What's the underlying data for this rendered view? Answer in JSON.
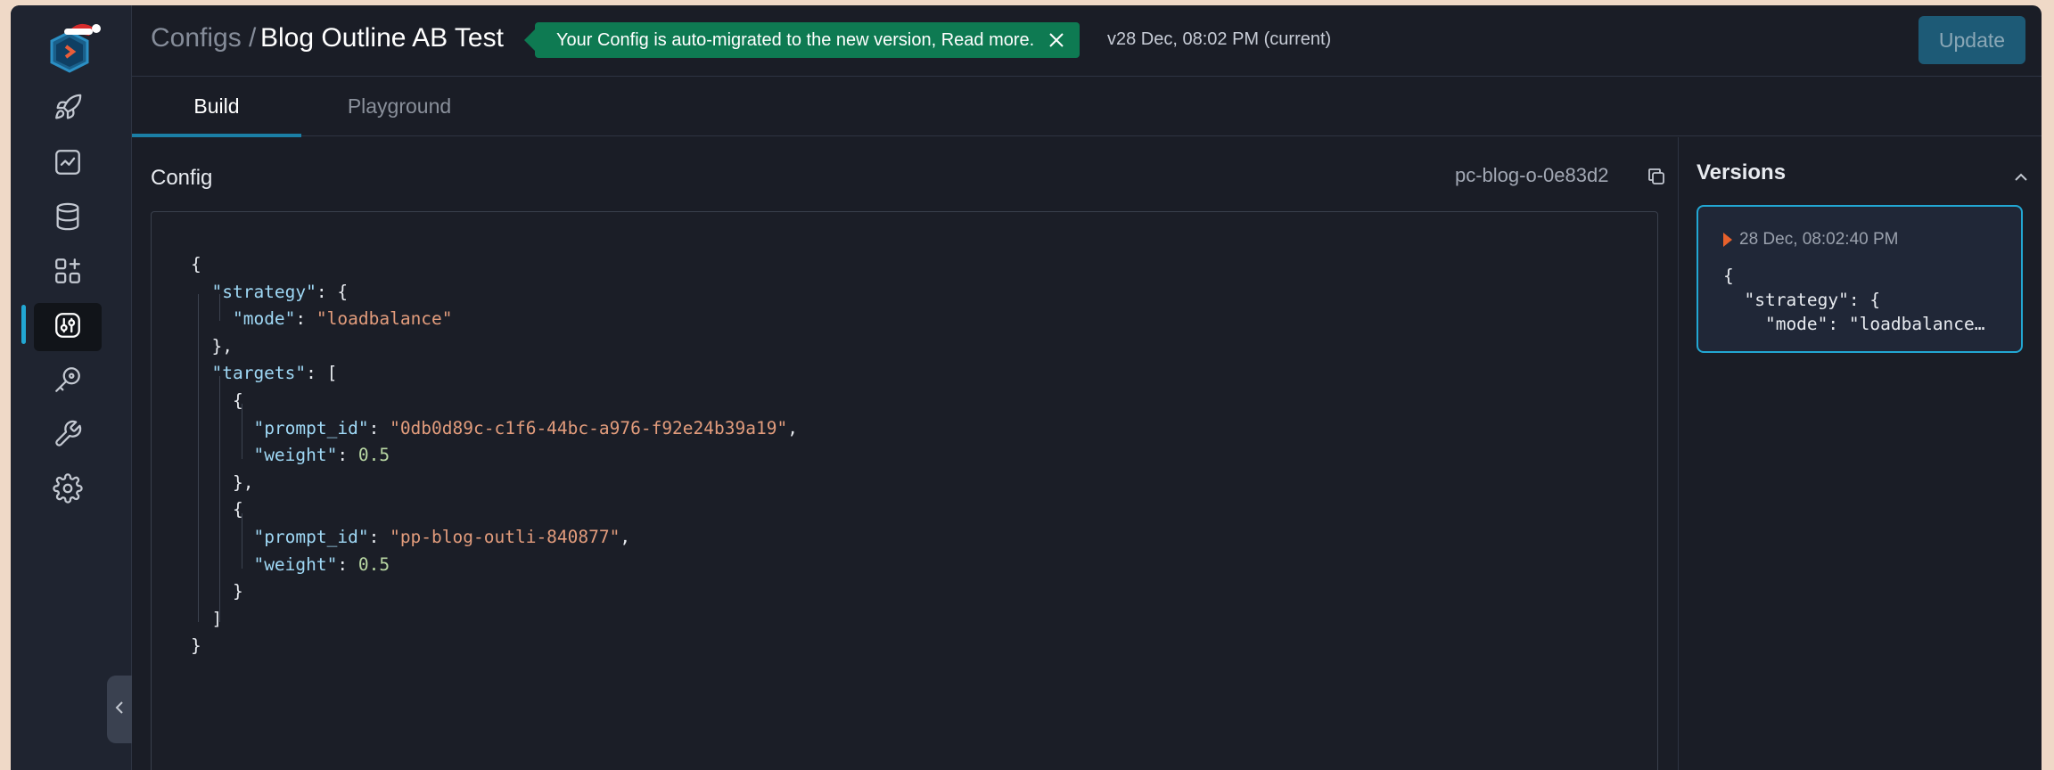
{
  "header": {
    "breadcrumb_parent": "Configs /",
    "title": "Blog Outline AB Test",
    "banner_text": "Your Config is auto-migrated to the new version, Read more.",
    "version_label": "v28 Dec, 08:02 PM (current)",
    "update_label": "Update"
  },
  "tabs": [
    {
      "label": "Build",
      "active": true
    },
    {
      "label": "Playground",
      "active": false
    }
  ],
  "sidebar": {
    "items": [
      {
        "icon": "rocket-icon"
      },
      {
        "icon": "analytics-icon"
      },
      {
        "icon": "database-icon"
      },
      {
        "icon": "add-widget-icon"
      },
      {
        "icon": "configs-icon",
        "active": true
      },
      {
        "icon": "key-icon"
      },
      {
        "icon": "wrench-icon"
      },
      {
        "icon": "gear-icon"
      }
    ]
  },
  "config": {
    "title": "Config",
    "id": "pc-blog-o-0e83d2",
    "lines": [
      {
        "indent": 0,
        "parts": [
          {
            "t": "p",
            "v": "{"
          }
        ]
      },
      {
        "indent": 1,
        "parts": [
          {
            "t": "k",
            "v": "\"strategy\""
          },
          {
            "t": "p",
            "v": ": {"
          }
        ]
      },
      {
        "indent": 2,
        "parts": [
          {
            "t": "k",
            "v": "\"mode\""
          },
          {
            "t": "p",
            "v": ": "
          },
          {
            "t": "s",
            "v": "\"loadbalance\""
          }
        ]
      },
      {
        "indent": 1,
        "parts": [
          {
            "t": "p",
            "v": "},"
          }
        ]
      },
      {
        "indent": 1,
        "parts": [
          {
            "t": "k",
            "v": "\"targets\""
          },
          {
            "t": "p",
            "v": ": ["
          }
        ]
      },
      {
        "indent": 2,
        "parts": [
          {
            "t": "p",
            "v": "{"
          }
        ]
      },
      {
        "indent": 3,
        "parts": [
          {
            "t": "k",
            "v": "\"prompt_id\""
          },
          {
            "t": "p",
            "v": ": "
          },
          {
            "t": "s",
            "v": "\"0db0d89c-c1f6-44bc-a976-f92e24b39a19\""
          },
          {
            "t": "p",
            "v": ","
          }
        ]
      },
      {
        "indent": 3,
        "parts": [
          {
            "t": "k",
            "v": "\"weight\""
          },
          {
            "t": "p",
            "v": ": "
          },
          {
            "t": "n",
            "v": "0.5"
          }
        ]
      },
      {
        "indent": 2,
        "parts": [
          {
            "t": "p",
            "v": "},"
          }
        ]
      },
      {
        "indent": 2,
        "parts": [
          {
            "t": "p",
            "v": "{"
          }
        ]
      },
      {
        "indent": 3,
        "parts": [
          {
            "t": "k",
            "v": "\"prompt_id\""
          },
          {
            "t": "p",
            "v": ": "
          },
          {
            "t": "s",
            "v": "\"pp-blog-outli-840877\""
          },
          {
            "t": "p",
            "v": ","
          }
        ]
      },
      {
        "indent": 3,
        "parts": [
          {
            "t": "k",
            "v": "\"weight\""
          },
          {
            "t": "p",
            "v": ": "
          },
          {
            "t": "n",
            "v": "0.5"
          }
        ]
      },
      {
        "indent": 2,
        "parts": [
          {
            "t": "p",
            "v": "}"
          }
        ]
      },
      {
        "indent": 1,
        "parts": [
          {
            "t": "p",
            "v": "]"
          }
        ]
      },
      {
        "indent": 0,
        "parts": [
          {
            "t": "p",
            "v": "}"
          }
        ]
      }
    ]
  },
  "versions": {
    "title": "Versions",
    "items": [
      {
        "timestamp": "28 Dec, 08:02:40 PM",
        "preview": "{\n  \"strategy\": {\n    \"mode\": \"loadbalance…"
      }
    ]
  },
  "colors": {
    "accent": "#22a7d3",
    "banner": "#0e7a52",
    "update_button": "#1d5a76",
    "json_key": "#9fd8f5",
    "json_string": "#e29c7c",
    "json_number": "#b8d7a3",
    "marker": "#e8612c"
  }
}
